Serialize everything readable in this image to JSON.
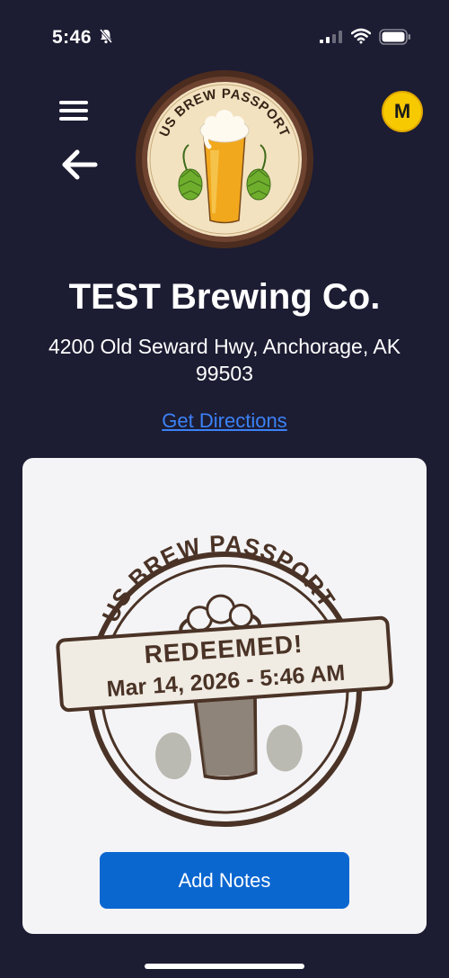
{
  "status_bar": {
    "time": "5:46",
    "icons": [
      "bell-slash-icon",
      "signal-icon",
      "wifi-icon",
      "battery-icon"
    ]
  },
  "header": {
    "menu_icon": "hamburger-menu-icon",
    "back_icon": "back-arrow-icon",
    "avatar_initial": "M",
    "avatar_color": "#f7c900",
    "logo_text": "US BREW PASSPORT"
  },
  "brewery": {
    "name": "TEST Brewing Co.",
    "address": "4200 Old Seward Hwy, Anchorage, AK 99503",
    "directions_label": "Get Directions"
  },
  "stamp": {
    "brand": "US BREW PASSPORT",
    "status": "REDEEMED!",
    "date": "Mar 14, 2026 - 5:46 AM",
    "ink_color": "#4a3326"
  },
  "actions": {
    "add_notes_label": "Add Notes"
  },
  "colors": {
    "background": "#1c1c33",
    "link": "#3b82f6",
    "button": "#0b67d0"
  }
}
